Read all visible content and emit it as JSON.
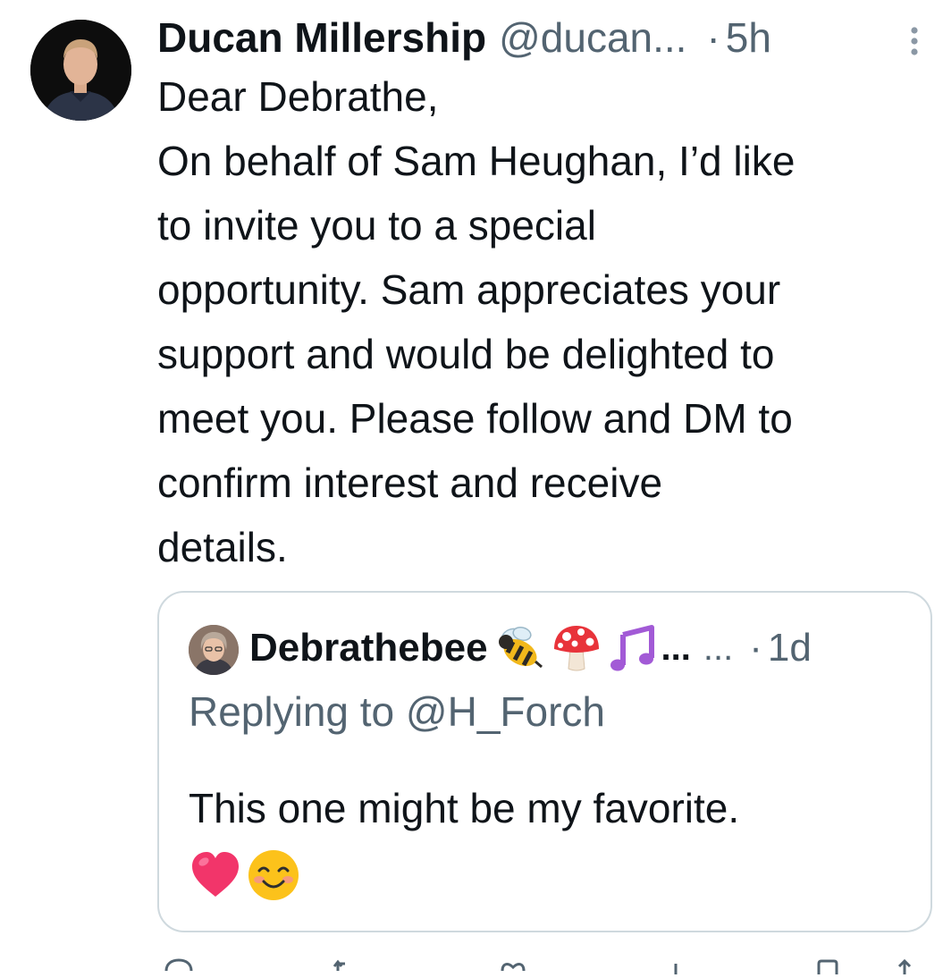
{
  "tweet": {
    "display_name": "Ducan Millership",
    "handle": "@ducan...",
    "separator": "·",
    "time": "5h",
    "body_lines": [
      "Dear Debrathe,",
      "On behalf of Sam Heughan, I’d like",
      "to invite you to a special",
      "opportunity. Sam appreciates your",
      "support and would be delighted to",
      "meet you. Please follow and DM to",
      "confirm interest and receive",
      "details."
    ]
  },
  "quote": {
    "display_name": "Debrathebee",
    "name_emojis": [
      "bee-emoji",
      "mushroom-emoji",
      "music-notes-emoji"
    ],
    "name_truncation": "...",
    "handle_truncation": "...",
    "separator": "·",
    "time": "1d",
    "replying_to": "Replying to @H_Forch",
    "text": "This one might be my favorite.",
    "text_emojis": [
      "heart-emoji",
      "smiling-face-emoji"
    ]
  },
  "icons": {
    "more": "more-vertical-icon",
    "actions": [
      "reply-icon",
      "retweet-icon",
      "like-icon",
      "views-icon",
      "share-icon"
    ]
  },
  "colors": {
    "text_primary": "#0f1419",
    "text_secondary": "#536471",
    "border": "#cfd9de"
  }
}
